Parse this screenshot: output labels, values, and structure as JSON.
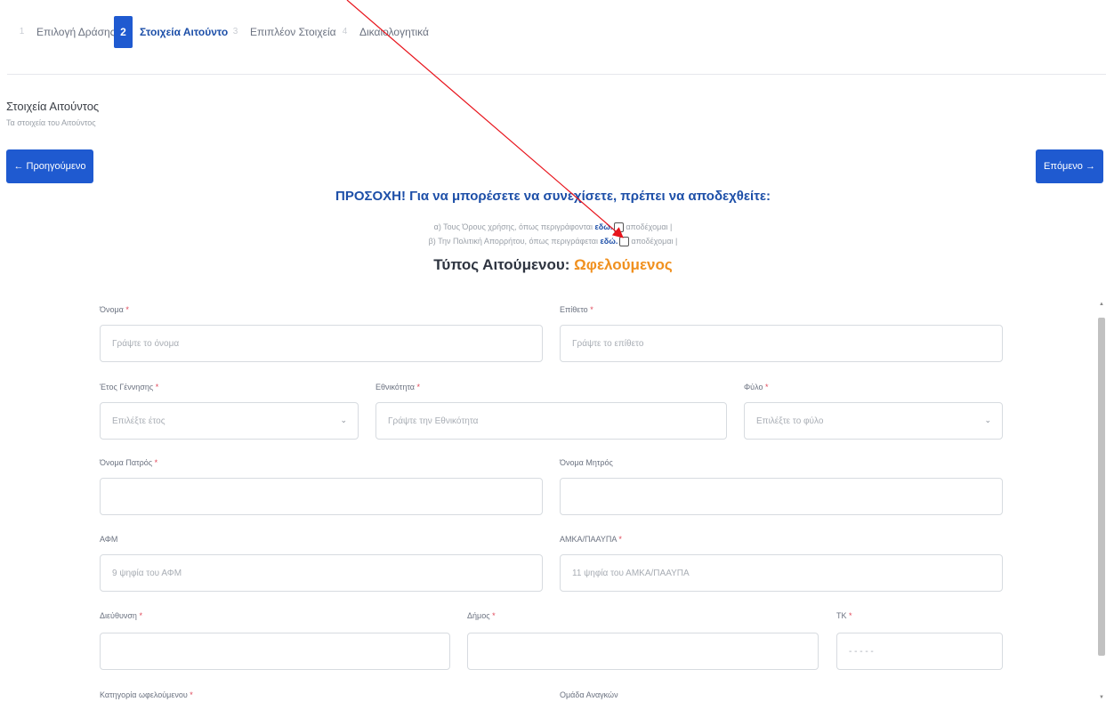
{
  "stepper": {
    "steps": [
      {
        "num": "1",
        "label": "Επιλογή Δράσης"
      },
      {
        "num": "2",
        "label": "Στοιχεία Αιτούντος"
      },
      {
        "num": "3",
        "label": "Επιπλέον Στοιχεία"
      },
      {
        "num": "4",
        "label": "Δικαιολογητικά"
      }
    ],
    "active_index": 1
  },
  "section": {
    "title": "Στοιχεία Αιτούντος",
    "subtitle": "Τα στοιχεία του Αιτούντος"
  },
  "nav": {
    "prev_label": "← Προηγούμενο",
    "next_label": "Επόμενο →"
  },
  "notice": {
    "warning": "ΠΡΟΣΟΧΗ! Για να μπορέσετε να συνεχίσετε, πρέπει να αποδεχθείτε:",
    "term_a_text": "α) Τους Όρους χρήσης, όπως περιγράφονται ",
    "term_b_text": "β) Την Πολιτική Απορρήτου, όπως περιγράφεται ",
    "link_label": "εδώ.",
    "accept_label": "αποδέχομαι |"
  },
  "request_type": {
    "label": "Τύπος Αιτούμενου: ",
    "value": "Ωφελούμενος"
  },
  "form": {
    "first_name": {
      "label": "Όνομα",
      "required": "*",
      "placeholder": "Γράψτε το όνομα"
    },
    "last_name": {
      "label": "Επίθετο",
      "required": "*",
      "placeholder": "Γράψτε το επίθετο"
    },
    "birth_year": {
      "label": "Έτος Γέννησης",
      "required": "*",
      "placeholder": "Επιλέξτε έτος"
    },
    "nationality": {
      "label": "Εθνικότητα",
      "required": "*",
      "placeholder": "Γράψτε την Εθνικότητα"
    },
    "gender": {
      "label": "Φύλο",
      "required": "*",
      "placeholder": "Επιλέξτε το φύλο"
    },
    "father_name": {
      "label": "Όνομα Πατρός",
      "required": "*",
      "placeholder": ""
    },
    "mother_name": {
      "label": "Όνομα Μητρός",
      "required": "",
      "placeholder": ""
    },
    "afm": {
      "label": "ΑΦΜ",
      "required": "",
      "placeholder": "9 ψηφία του ΑΦΜ"
    },
    "amka": {
      "label": "ΑΜΚΑ/ΠΑΑΥΠΑ",
      "required": "*",
      "placeholder": "11 ψηφία του ΑΜΚΑ/ΠΑΑΥΠΑ"
    },
    "address": {
      "label": "Διεύθυνση",
      "required": "*",
      "placeholder": ""
    },
    "municipality": {
      "label": "Δήμος",
      "required": "*",
      "placeholder": ""
    },
    "postal_code": {
      "label": "ΤΚ",
      "required": "*",
      "placeholder": "- - - - -"
    },
    "beneficiary_category": {
      "label": "Κατηγορία ωφελούμενου",
      "required": "*"
    },
    "needs_group": {
      "label": "Ομάδα Αναγκών",
      "required": ""
    }
  },
  "icons": {
    "chevron": "chevron-down-icon",
    "arrow": "red-annotation-arrow"
  },
  "colors": {
    "primary": "#1f5ad0",
    "accent": "#f0901e",
    "required": "#e0485a",
    "annotation": "#e8141c"
  }
}
